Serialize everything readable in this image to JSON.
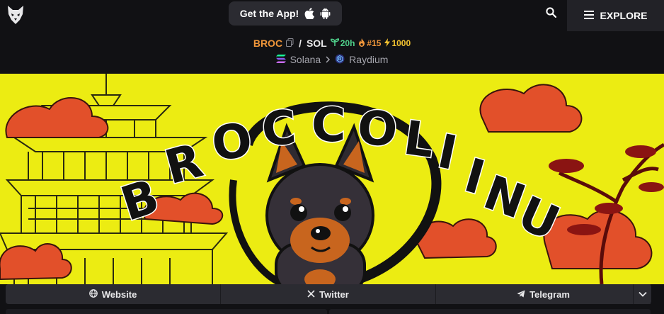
{
  "header": {
    "app_button_label": "Get the App!",
    "app_icons": [
      "apple-icon",
      "android-icon"
    ],
    "search_icon": "search-icon",
    "explore_label": "EXPLORE"
  },
  "pair": {
    "base": "BROC",
    "separator": "/",
    "quote": "SOL",
    "age": "20h",
    "rank": "#15",
    "boost": "1000"
  },
  "breadcrumb": {
    "chain": "Solana",
    "dex": "Raydium"
  },
  "banner": {
    "title": "BROCCOLI INU"
  },
  "links": {
    "website": "Website",
    "twitter": "Twitter",
    "telegram": "Telegram"
  },
  "colors": {
    "background": "#111114",
    "accent_orange": "#f0963a",
    "age_green": "#4fd18b",
    "boost_yellow": "#f2c230",
    "banner_yellow": "#ecec12"
  }
}
